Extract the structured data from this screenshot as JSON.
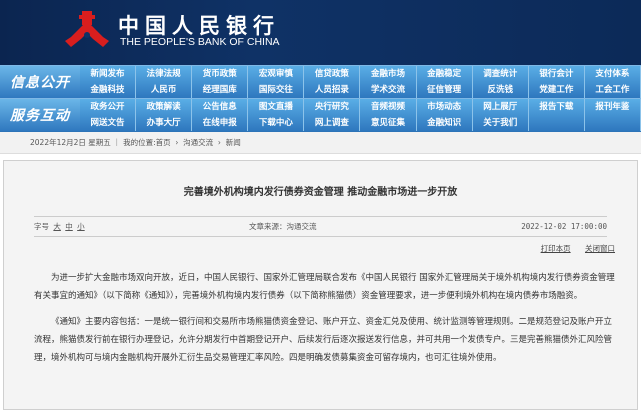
{
  "header": {
    "logo_cn": "中国人民银行",
    "logo_en": "THE PEOPLE'S BANK OF CHINA"
  },
  "nav": [
    {
      "label": "信息公开",
      "items": [
        "新闻发布",
        "法律法规",
        "货币政策",
        "宏观审慎",
        "信贷政策",
        "金融市场",
        "金融稳定",
        "调查统计",
        "银行会计",
        "支付体系",
        "金融科技",
        "人民币",
        "经理国库",
        "国际交往",
        "人员招录",
        "学术交流",
        "征信管理",
        "反洗钱",
        "党建工作",
        "工会工作"
      ]
    },
    {
      "label": "服务互动",
      "items": [
        "政务公开",
        "政策解读",
        "公告信息",
        "图文直播",
        "央行研究",
        "音频视频",
        "市场动态",
        "网上展厅",
        "报告下载",
        "报刊年鉴",
        "网送文告",
        "办事大厅",
        "在线申报",
        "下载中心",
        "网上调查",
        "意见征集",
        "金融知识",
        "关于我们",
        "",
        ""
      ]
    }
  ],
  "breadcrumb": {
    "date": "2022年12月2日 星期五",
    "location_label": "我的位置:",
    "items": [
      "首页",
      "沟通交流",
      "新闻"
    ]
  },
  "article": {
    "title": "完善境外机构境内发行债券资金管理 推动金融市场进一步开放",
    "font_label": "字号",
    "font_sizes": [
      "大",
      "中",
      "小"
    ],
    "source": "文章来源：沟通交流",
    "datetime": "2022-12-02 17:00:00",
    "print": "打印本页",
    "close": "关闭窗口",
    "paragraphs": [
      "为进一步扩大金融市场双向开放，近日，中国人民银行、国家外汇管理局联合发布《中国人民银行 国家外汇管理局关于境外机构境内发行债券资金管理有关事宜的通知》（以下简称《通知》），完善境外机构境内发行债券（以下简称熊猫债）资金管理要求，进一步便利境外机构在境内债券市场融资。",
      "《通知》主要内容包括：一是统一银行间和交易所市场熊猫债资金登记、账户开立、资金汇兑及使用、统计监测等管理规则。二是规范登记及账户开立流程，熊猫债发行前在银行办理登记，允许分期发行中首期登记开户、后续发行后逐次报送发行信息，并可共用一个发债专户。三是完善熊猫债外汇风险管理，境外机构可与境内金融机构开展外汇衍生品交易管理汇率风险。四是明确发债募集资金可留存境内，也可汇往境外使用。"
    ]
  }
}
